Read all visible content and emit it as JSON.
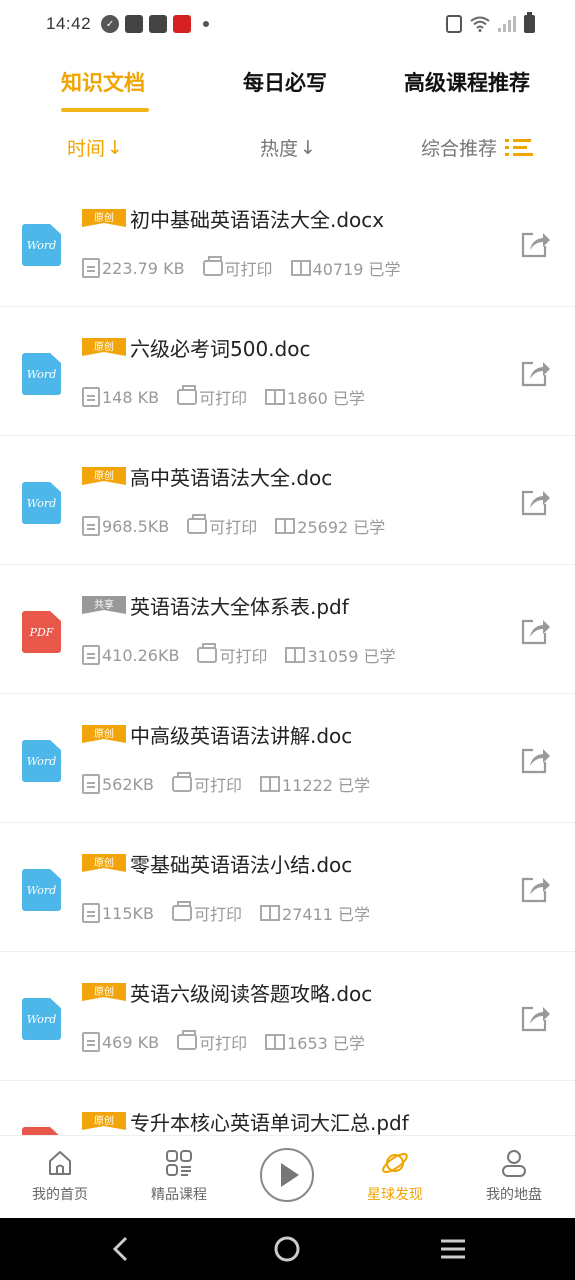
{
  "status_bar": {
    "time": "14:42"
  },
  "top_tabs": [
    {
      "label": "知识文档",
      "active": true
    },
    {
      "label": "每日必写",
      "active": false
    },
    {
      "label": "高级课程推荐",
      "active": false
    }
  ],
  "sort_bar": {
    "time": "时间",
    "heat": "热度",
    "recommend": "综合推荐",
    "arrow": "↓"
  },
  "docs": [
    {
      "type": "Word",
      "tag": "原创",
      "title": "初中基础英语语法大全.docx",
      "size": "223.79 KB",
      "printable": "可打印",
      "learners": "40719 已学"
    },
    {
      "type": "Word",
      "tag": "原创",
      "title": "六级必考词500.doc",
      "size": "148 KB",
      "printable": "可打印",
      "learners": "1860 已学"
    },
    {
      "type": "Word",
      "tag": "原创",
      "title": "高中英语语法大全.doc",
      "size": "968.5KB",
      "printable": "可打印",
      "learners": "25692 已学"
    },
    {
      "type": "PDF",
      "tag": "共享",
      "title": "英语语法大全体系表.pdf",
      "size": "410.26KB",
      "printable": "可打印",
      "learners": "31059 已学"
    },
    {
      "type": "Word",
      "tag": "原创",
      "title": "中高级英语语法讲解.doc",
      "size": "562KB",
      "printable": "可打印",
      "learners": "11222 已学"
    },
    {
      "type": "Word",
      "tag": "原创",
      "title": "零基础英语语法小结.doc",
      "size": "115KB",
      "printable": "可打印",
      "learners": "27411 已学"
    },
    {
      "type": "Word",
      "tag": "原创",
      "title": "英语六级阅读答题攻略.doc",
      "size": "469 KB",
      "printable": "可打印",
      "learners": "1653 已学"
    },
    {
      "type": "PDF",
      "tag": "原创",
      "title": "专升本核心英语单词大汇总.pdf",
      "size": "",
      "printable": "",
      "learners": ""
    }
  ],
  "bottom_nav": [
    {
      "label": "我的首页",
      "icon": "home-icon",
      "active": false
    },
    {
      "label": "精品课程",
      "icon": "grid-icon",
      "active": false
    },
    {
      "label": "星球发现",
      "icon": "planet-icon",
      "active": true
    },
    {
      "label": "我的地盘",
      "icon": "user-icon",
      "active": false
    }
  ],
  "colors": {
    "accent": "#f0a400",
    "word": "#4cb7e8",
    "pdf": "#e8574a",
    "share_tag": "#999999"
  }
}
